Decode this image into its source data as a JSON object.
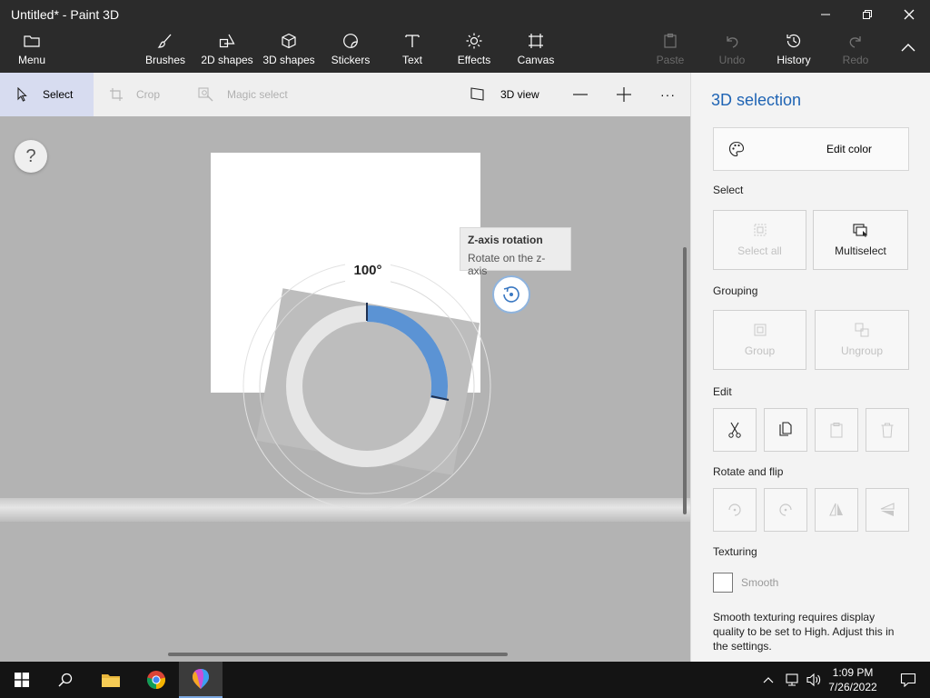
{
  "window": {
    "title": "Untitled* - Paint 3D"
  },
  "ribbon": {
    "menu": "Menu",
    "brushes": "Brushes",
    "shapes2d": "2D shapes",
    "shapes3d": "3D shapes",
    "stickers": "Stickers",
    "text": "Text",
    "effects": "Effects",
    "canvas": "Canvas",
    "paste": "Paste",
    "undo": "Undo",
    "history": "History",
    "redo": "Redo"
  },
  "toolbar": {
    "select": "Select",
    "crop": "Crop",
    "magic_select": "Magic select",
    "view3d": "3D view",
    "more": "···"
  },
  "canvas": {
    "help": "?",
    "rotation_degrees": "100°",
    "tooltip_title": "Z-axis rotation",
    "tooltip_desc": "Rotate on the z-axis"
  },
  "panel": {
    "title": "3D selection",
    "edit_color": "Edit color",
    "select_heading": "Select",
    "select_all": "Select all",
    "multiselect": "Multiselect",
    "grouping_heading": "Grouping",
    "group": "Group",
    "ungroup": "Ungroup",
    "edit_heading": "Edit",
    "rotate_heading": "Rotate and flip",
    "texturing_heading": "Texturing",
    "smooth": "Smooth",
    "note": "Smooth texturing requires display quality to be set to High. Adjust this in the settings."
  },
  "taskbar": {
    "time": "1:09 PM",
    "date": "7/26/2022"
  },
  "colors": {
    "accent": "#1f64b4",
    "dial_fill": "#5b93d4",
    "titlebar": "#2b2b2b"
  },
  "icons": [
    "folder-icon",
    "brush-icon",
    "shapes-2d-icon",
    "cube-icon",
    "sticker-icon",
    "text-icon",
    "effects-icon",
    "canvas-icon",
    "paste-icon",
    "undo-icon",
    "history-icon",
    "redo-icon",
    "chevron-up-icon"
  ]
}
